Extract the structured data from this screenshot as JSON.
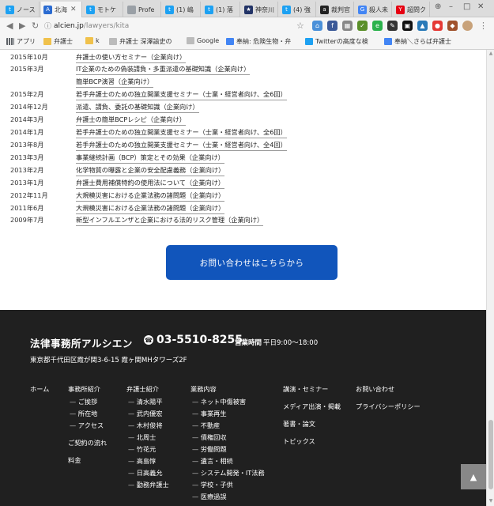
{
  "browser": {
    "tabs": [
      {
        "label": "ノース",
        "icon": "twitter-icon",
        "color": "#1da1f2"
      },
      {
        "label": "北海",
        "icon": "azure-icon",
        "color": "#2a6bd1",
        "active": true
      },
      {
        "label": "モトケ",
        "icon": "twitter-icon",
        "color": "#1da1f2"
      },
      {
        "label": "Profe",
        "icon": "document-icon",
        "color": "#9aa0a6"
      },
      {
        "label": "(1) 嶋",
        "icon": "twitter-icon",
        "color": "#1da1f2"
      },
      {
        "label": "(1) 落",
        "icon": "twitter-icon",
        "color": "#1da1f2"
      },
      {
        "label": "神奈川",
        "icon": "police-emblem-icon",
        "color": "#223366"
      },
      {
        "label": "(4) 強",
        "icon": "twitter-icon",
        "color": "#1da1f2"
      },
      {
        "label": "裁判官",
        "icon": "amazon-icon",
        "color": "#222222"
      },
      {
        "label": "殺人未",
        "icon": "google-icon",
        "color": "#4285f4"
      },
      {
        "label": "超問ク",
        "icon": "yahoo-icon",
        "color": "#e60012"
      }
    ],
    "address": {
      "host": "alcien.jp",
      "path": "/lawyers/kita"
    },
    "bookmarks": [
      {
        "label": "アプリ",
        "icon": "apps-grid-icon"
      },
      {
        "label": "弁護士",
        "icon": "folder-icon"
      },
      {
        "label": "k",
        "icon": "folder-icon"
      },
      {
        "label": "弁護士 深澤諭史の",
        "icon": "document-icon"
      },
      {
        "label": "Google",
        "icon": "document-icon"
      },
      {
        "label": "奉納: 危険生物・弁",
        "icon": "g-icon"
      },
      {
        "label": "Twitterの高度な検",
        "icon": "twitter-icon"
      },
      {
        "label": "奉納＼さらば弁護士",
        "icon": "g-icon"
      }
    ]
  },
  "history": [
    {
      "date": "2015年10月",
      "title": "弁護士の使い方セミナー（企業向け）"
    },
    {
      "date": "2015年3月",
      "title": "IT企業のための偽装請負・多重派遣の基礎知識（企業向け）"
    },
    {
      "date": "",
      "title": "簡単BCP演習（企業向け）"
    },
    {
      "date": "2015年2月",
      "title": "若手弁護士のための独立開業支援セミナー（士業・経営者向け、全6回）"
    },
    {
      "date": "2014年12月",
      "title": "派遣、請負、委託の基礎知識（企業向け）"
    },
    {
      "date": "2014年3月",
      "title": "弁護士の簡単BCPレシピ（企業向け）"
    },
    {
      "date": "2014年1月",
      "title": "若手弁護士のための独立開業支援セミナー（士業・経営者向け、全6回）"
    },
    {
      "date": "2013年8月",
      "title": "若手弁護士のための独立開業支援セミナー（士業・経営者向け、全4回）"
    },
    {
      "date": "2013年3月",
      "title": "事業継続計画（BCP）策定とその効果（企業向け）"
    },
    {
      "date": "2013年2月",
      "title": "化学物質の曝露と企業の安全配慮義務（企業向け）"
    },
    {
      "date": "2013年1月",
      "title": "弁護士費用補償特約の使用法について（企業向け）"
    },
    {
      "date": "2012年11月",
      "title": "大規模災害における企業法務の諸問題（企業向け）"
    },
    {
      "date": "2011年6月",
      "title": "大規模災害における企業法務の諸問題（企業向け）"
    },
    {
      "date": "2009年7月",
      "title": "新型インフルエンザと企業における法的リスク管理（企業向け）"
    }
  ],
  "cta": {
    "label": "お問い合わせはこちらから"
  },
  "footer": {
    "firm_name": "法律事務所アルシエン",
    "phone": "03-5510-8255",
    "hours_label": "営業時間",
    "hours": "平日9:00～18:00",
    "address": "東京都千代田区霞が関3-6-15 霞ヶ関MHタワーズ2F",
    "col_home": "ホーム",
    "col_office": {
      "title": "事務所紹介",
      "items": [
        "ご挨拶",
        "所在地",
        "アクセス"
      ],
      "extra": [
        "ご契約の流れ",
        "料金"
      ]
    },
    "col_lawyers": {
      "title": "弁護士紹介",
      "items": [
        "清水陽平",
        "武内優宏",
        "木村俊将",
        "北周士",
        "竹花元",
        "高島惇",
        "日高義允",
        "勤務弁護士"
      ]
    },
    "col_services": {
      "title": "業務内容",
      "items": [
        "ネット中傷被害",
        "事業再生",
        "不動産",
        "債権回収",
        "労働問題",
        "遺言・相続",
        "システム開発・IT法務",
        "学校・子供",
        "医療過誤"
      ]
    },
    "col_misc": [
      "講演・セミナー",
      "メディア出演・掲載",
      "著書・論文",
      "トピックス"
    ],
    "col_contact": [
      "お問い合わせ",
      "プライバシーポリシー"
    ]
  },
  "scroll_top_label": "▲"
}
